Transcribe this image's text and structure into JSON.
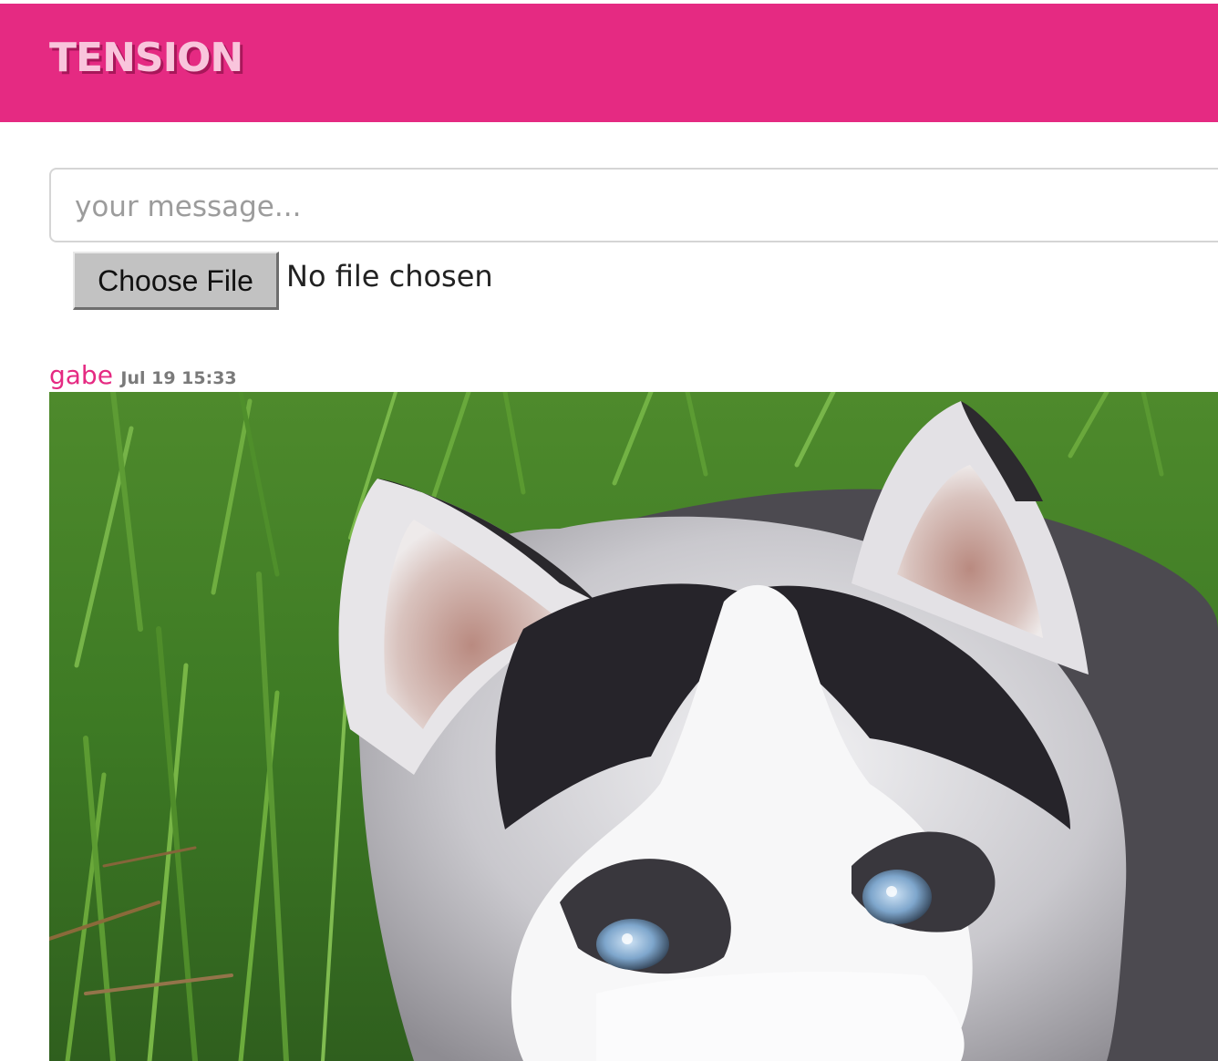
{
  "app": {
    "brand": "TENSION"
  },
  "composer": {
    "placeholder": "your message...",
    "value": ""
  },
  "file_input": {
    "button_label": "Choose File",
    "status": "No file chosen"
  },
  "messages": [
    {
      "user": "gabe",
      "timestamp": "Jul 19 15:33",
      "attachment": {
        "kind": "image",
        "subject": "husky-puppy-photo"
      }
    }
  ],
  "colors": {
    "accent": "#e52a82",
    "brand_text": "#f9c5dc",
    "brand_shadow": "#a8175a"
  }
}
